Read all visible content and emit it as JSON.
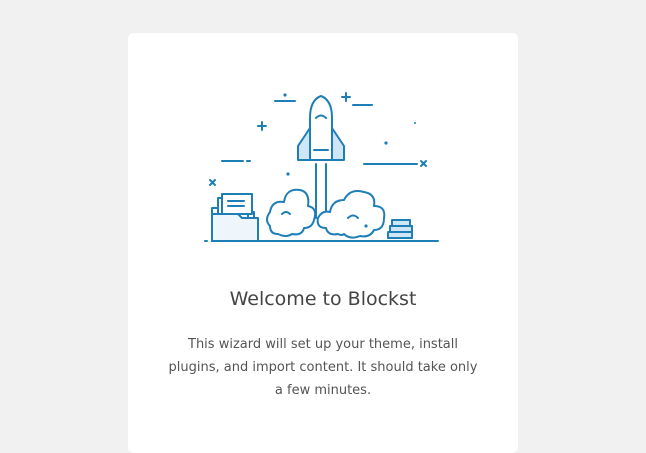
{
  "welcome": {
    "title": "Welcome to Blockst",
    "description": "This wizard will set up your theme, install plugins, and import content. It should take only a few minutes."
  },
  "colors": {
    "background": "#f1f1f1",
    "card": "#ffffff",
    "accent": "#1e7fb8",
    "accent_light": "#cfe6f7"
  },
  "icons": {
    "illustration": "rocket-launch-illustration"
  }
}
